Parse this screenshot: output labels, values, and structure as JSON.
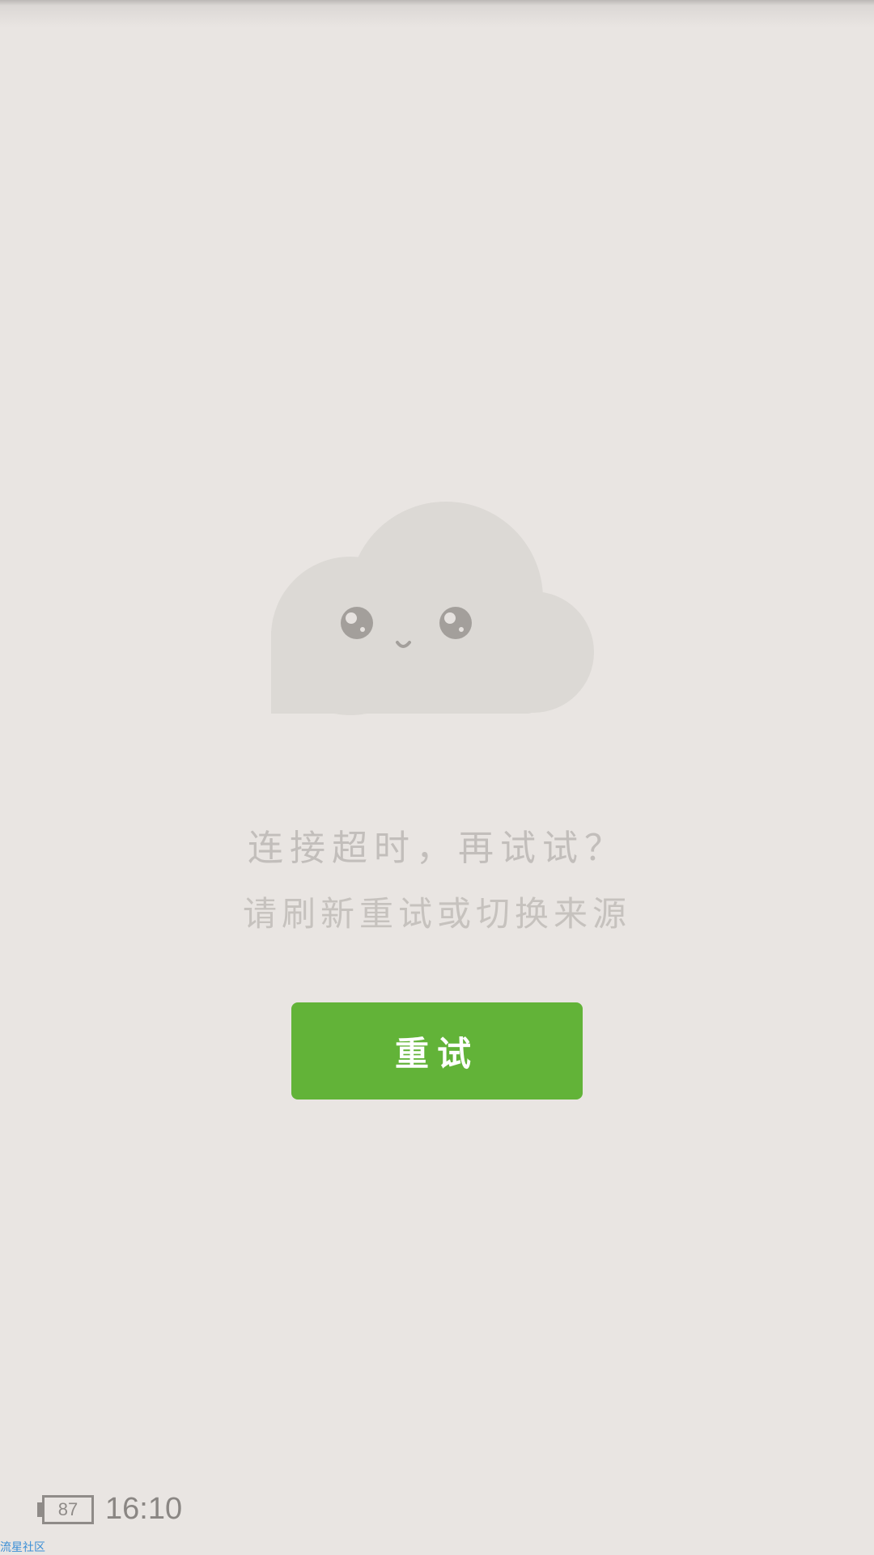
{
  "message": {
    "title": "连接超时，再试试？",
    "subtitle": "请刷新重试或切换来源"
  },
  "retry_button": {
    "label": "重试",
    "color": "#62b338"
  },
  "illustration": {
    "icon": "sad-cloud-icon",
    "cloud_color": "#dcd9d5",
    "eye_color": "#a39f9b"
  },
  "status_bar": {
    "battery_level": "87",
    "time": "16:10"
  },
  "watermark": {
    "text": "流星社区"
  }
}
